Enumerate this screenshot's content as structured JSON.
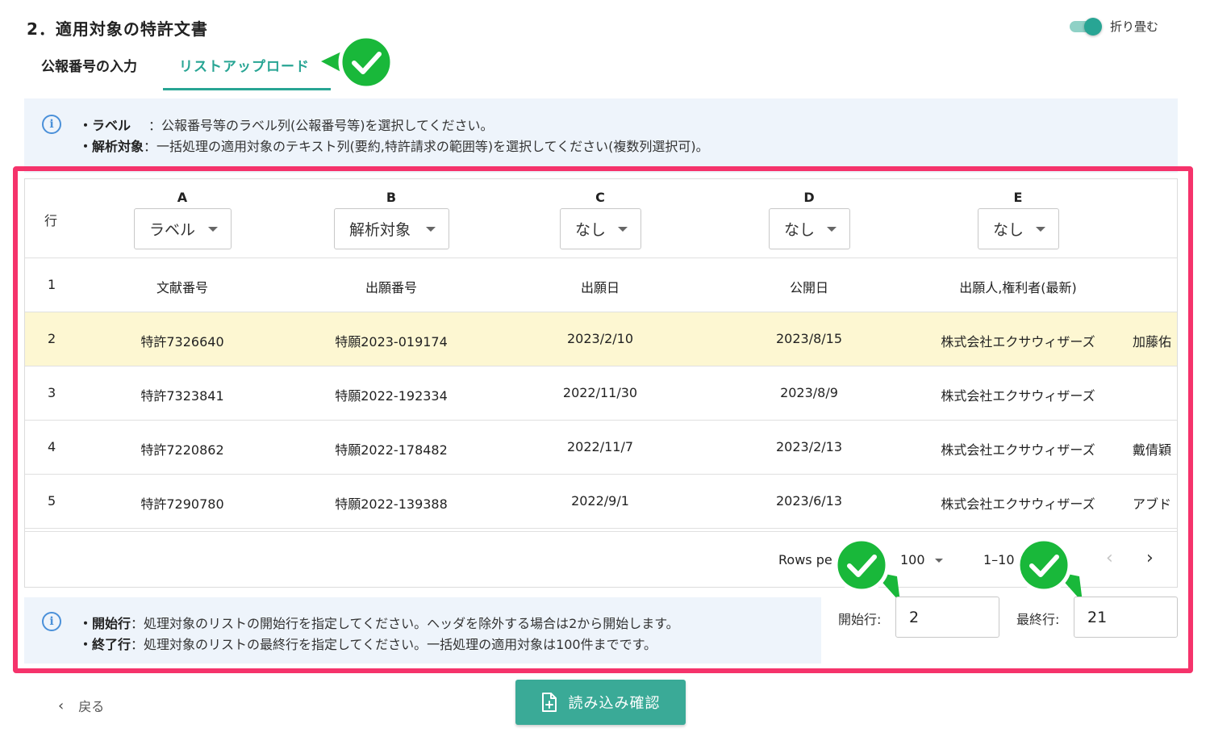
{
  "section": {
    "title": "2．適用対象の特許文書"
  },
  "collapse": {
    "label": "折り畳む",
    "on": true
  },
  "tabs": [
    {
      "label": "公報番号の入力",
      "active": false
    },
    {
      "label": "リストアップロード",
      "active": true
    }
  ],
  "info_top": {
    "line1_key": "・ラベル",
    "line1_sep": "：",
    "line1_text": "公報番号等のラベル列(公報番号等)を選択してください。",
    "line2_key": "・解析対象",
    "line2_sep": "：",
    "line2_text": "一括処理の適用対象のテキスト列(要約,特許請求の範囲等)を選択してください(複数列選択可)。"
  },
  "table": {
    "row_header": "行",
    "columns": [
      {
        "letter": "A",
        "mapping": "ラベル"
      },
      {
        "letter": "B",
        "mapping": "解析対象"
      },
      {
        "letter": "C",
        "mapping": "なし"
      },
      {
        "letter": "D",
        "mapping": "なし"
      },
      {
        "letter": "E",
        "mapping": "なし"
      }
    ],
    "rows": [
      {
        "n": "1",
        "cells": [
          "文献番号",
          "出願番号",
          "出願日",
          "公開日",
          "出願人,権利者(最新)"
        ],
        "extra": ""
      },
      {
        "n": "2",
        "cells": [
          "特許7326640",
          "特願2023-019174",
          "2023/2/10",
          "2023/8/15",
          "株式会社エクサウィザーズ"
        ],
        "extra": "加藤佑"
      },
      {
        "n": "3",
        "cells": [
          "特許7323841",
          "特願2022-192334",
          "2022/11/30",
          "2023/8/9",
          "株式会社エクサウィザーズ"
        ],
        "extra": ""
      },
      {
        "n": "4",
        "cells": [
          "特許7220862",
          "特願2022-178482",
          "2022/11/7",
          "2023/2/13",
          "株式会社エクサウィザーズ"
        ],
        "extra": "戴倩穎"
      },
      {
        "n": "5",
        "cells": [
          "特許7290780",
          "特願2022-139388",
          "2022/9/1",
          "2023/6/13",
          "株式会社エクサウィザーズ"
        ],
        "extra": "アブド"
      }
    ],
    "pager": {
      "rows_per_page_label": "Rows pe",
      "rows_per_page": "100",
      "range": "1–10"
    }
  },
  "info_bottom": {
    "line1_key": "・開始行",
    "line1_sep": "：",
    "line1_text": "処理対象のリストの開始行を指定してください。ヘッダを除外する場合は2から開始します。",
    "line2_key": "・終了行",
    "line2_sep": "：",
    "line2_text": "処理対象のリストの最終行を指定してください。一括処理の適用対象は100件までです。"
  },
  "range": {
    "start_label": "開始行:",
    "start_value": "2",
    "end_label": "最終行:",
    "end_value": "21"
  },
  "footer": {
    "back_label": "戻る",
    "confirm_label": "読み込み確認"
  },
  "colors": {
    "accent": "#28a594",
    "highlight_frame": "#f5336b",
    "check_green": "#19b83a",
    "row_highlight": "#fdf7d2"
  }
}
